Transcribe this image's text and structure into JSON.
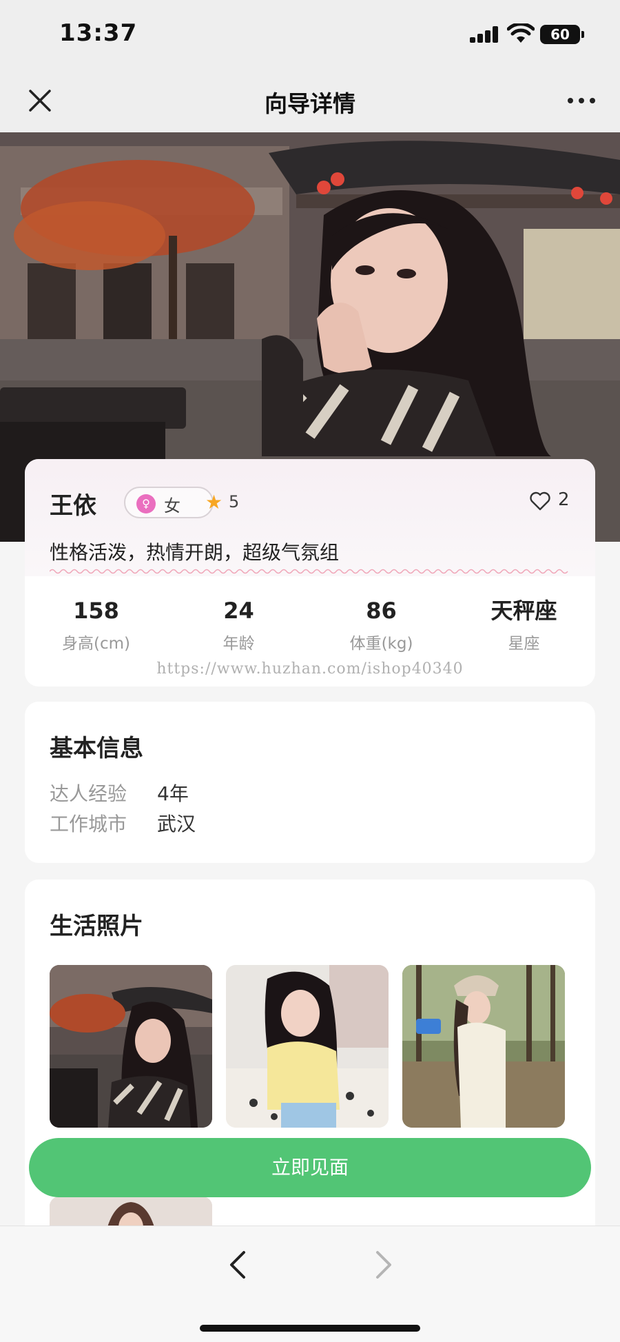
{
  "status_bar": {
    "time": "13:37",
    "battery": "60"
  },
  "nav": {
    "title": "向导详情"
  },
  "profile": {
    "name": "王依",
    "gender": "女",
    "rating": "5",
    "likes": "2",
    "tagline": "性格活泼，热情开朗，超级气氛组",
    "stats": [
      {
        "value": "158",
        "label": "身高(cm)"
      },
      {
        "value": "24",
        "label": "年龄"
      },
      {
        "value": "86",
        "label": "体重(kg)"
      },
      {
        "value": "天秤座",
        "label": "星座"
      }
    ],
    "watermark": "https://www.huzhan.com/ishop40340"
  },
  "basic_info": {
    "title": "基本信息",
    "rows": [
      {
        "key": "达人经验",
        "value": "4年"
      },
      {
        "key": "工作城市",
        "value": "武汉"
      }
    ]
  },
  "photos": {
    "title": "生活照片"
  },
  "actions": {
    "meet_label": "立即见面"
  },
  "colors": {
    "accent": "#52c575",
    "gender_badge": "#ea6fbf",
    "star": "#f7a623"
  }
}
